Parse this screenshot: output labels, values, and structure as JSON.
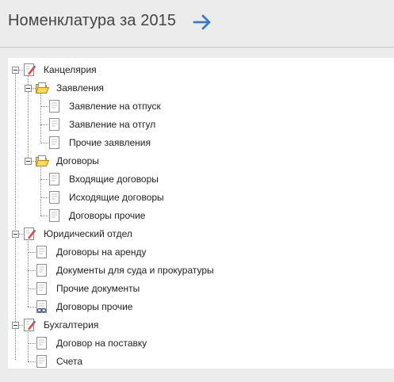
{
  "header": {
    "title": "Номенклатура за 2015"
  },
  "accent": "#3a7cc4",
  "tree": [
    {
      "label": "Канцелярия",
      "icon": "document-pen-icon"
    },
    {
      "label": "Заявления",
      "icon": "folder-open-icon"
    },
    {
      "label": "Заявление на отпуск",
      "icon": "document-icon"
    },
    {
      "label": "Заявление на отгул",
      "icon": "document-icon"
    },
    {
      "label": "Прочие заявления",
      "icon": "document-icon"
    },
    {
      "label": "Договоры",
      "icon": "folder-open-icon"
    },
    {
      "label": "Входящие договоры",
      "icon": "document-icon"
    },
    {
      "label": "Исходящие договоры",
      "icon": "document-icon"
    },
    {
      "label": "Договоры прочие",
      "icon": "document-icon"
    },
    {
      "label": "Юридический отдел",
      "icon": "document-pen-icon"
    },
    {
      "label": "Договоры на аренду",
      "icon": "document-icon"
    },
    {
      "label": "Документы для суда и прокуратуры",
      "icon": "document-icon"
    },
    {
      "label": "Прочие документы",
      "icon": "document-icon"
    },
    {
      "label": "Договоры прочие",
      "icon": "document-link-icon"
    },
    {
      "label": "Бухгалтерия",
      "icon": "document-pen-icon"
    },
    {
      "label": "Договор на поставку",
      "icon": "document-icon"
    },
    {
      "label": "Счета",
      "icon": "document-icon"
    }
  ]
}
